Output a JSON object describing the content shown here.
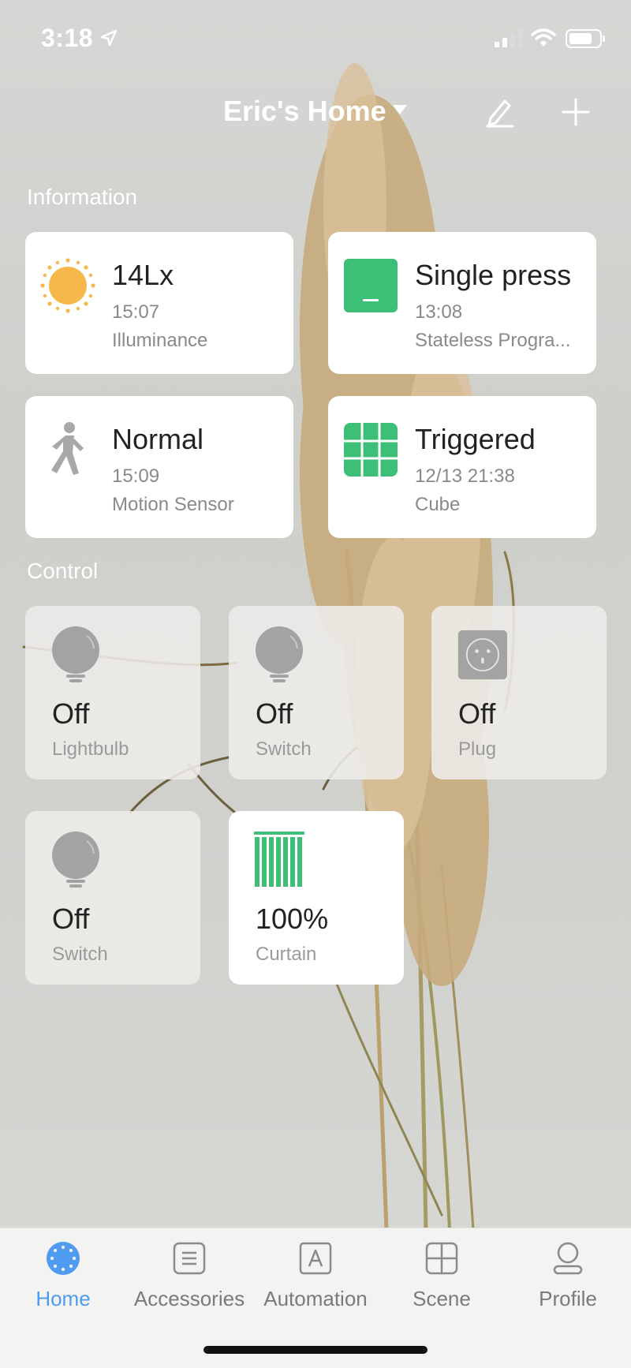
{
  "status_bar": {
    "time": "3:18",
    "icons": [
      "location-arrow-icon",
      "signal-icon",
      "wifi-icon",
      "battery-icon"
    ]
  },
  "header": {
    "title": "Eric's Home",
    "icons": [
      "caret-down-icon",
      "edit-icon",
      "add-icon"
    ]
  },
  "information": {
    "title": "Information",
    "cards": [
      {
        "value": "14Lx",
        "time": "15:07",
        "label": "Illuminance",
        "icon": "sun-icon"
      },
      {
        "value": "Single press",
        "time": "13:08",
        "label": "Stateless Progra...",
        "icon": "switch-button-icon"
      },
      {
        "value": "Normal",
        "time": "15:09",
        "label": "Motion Sensor",
        "icon": "walking-person-icon"
      },
      {
        "value": "Triggered",
        "time": "12/13 21:38",
        "label": "Cube",
        "icon": "cube-grid-icon"
      }
    ]
  },
  "control": {
    "title": "Control",
    "tiles": [
      {
        "state": "Off",
        "label": "Lightbulb",
        "icon": "lightbulb-icon"
      },
      {
        "state": "Off",
        "label": "Switch",
        "icon": "lightbulb-icon"
      },
      {
        "state": "Off",
        "label": "Plug",
        "icon": "plug-icon"
      },
      {
        "state": "Off",
        "label": "Switch",
        "icon": "lightbulb-icon"
      },
      {
        "state": "100%",
        "label": "Curtain",
        "icon": "curtain-icon"
      }
    ]
  },
  "tab_bar": {
    "tabs": [
      {
        "label": "Home",
        "icon": "home-dots-icon",
        "active": true
      },
      {
        "label": "Accessories",
        "icon": "accessories-list-icon",
        "active": false
      },
      {
        "label": "Automation",
        "icon": "automation-icon",
        "active": false
      },
      {
        "label": "Scene",
        "icon": "scene-grid-icon",
        "active": false
      },
      {
        "label": "Profile",
        "icon": "profile-icon",
        "active": false
      }
    ]
  },
  "colors": {
    "accent": "#4f9bf0",
    "green": "#3dbf78",
    "sun": "#f6b84b",
    "inactive_icon": "#a3a3a3"
  }
}
